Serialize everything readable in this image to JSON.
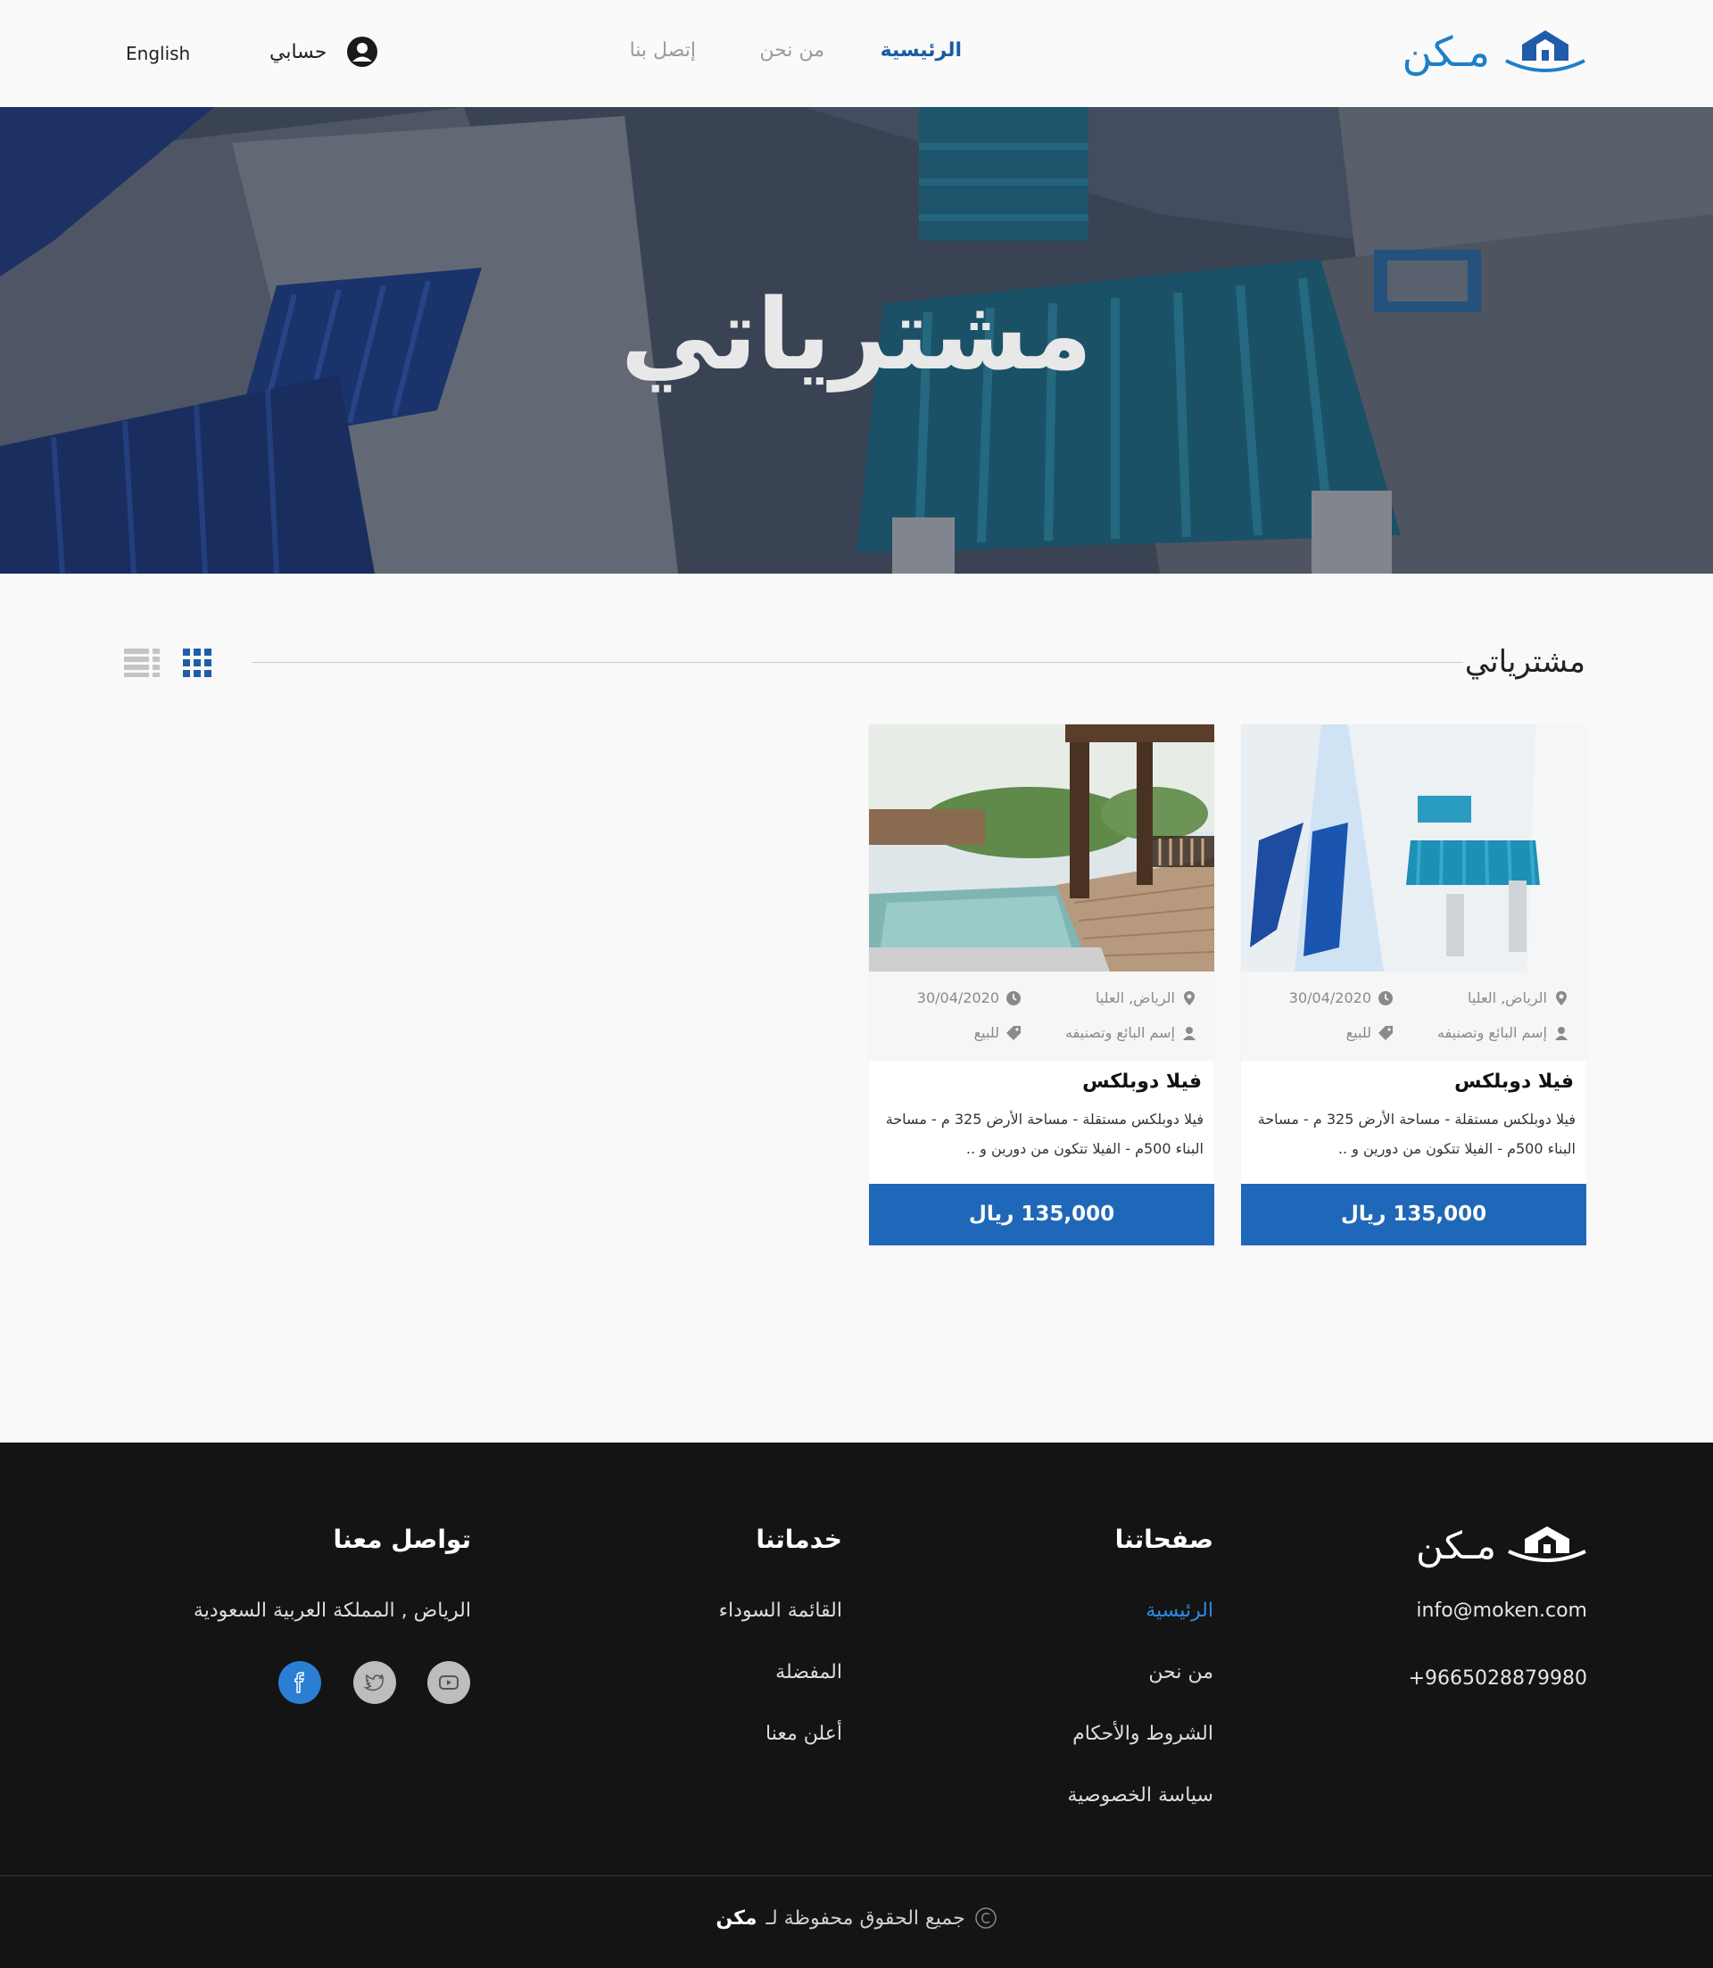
{
  "header": {
    "logo_text": "مـكن",
    "nav": {
      "home": "الرئيسية",
      "about": "من نحن",
      "contact": "إتصل بنا"
    },
    "account_label": "حسابي",
    "language": "English"
  },
  "hero": {
    "title": "مشترياتي"
  },
  "section": {
    "title": "مشترياتي"
  },
  "cards": [
    {
      "location": "الرياض, العليا",
      "date": "30/04/2020",
      "seller": "إسم البائع وتصنيفه",
      "type": "للبيع",
      "title": "فيلا دوبلكس",
      "description": "فيلا دوبلكس مستقلة - مساحة الأرض 325 م - مساحة البناء 500م - الفيلا تتكون من دورين و ..",
      "price": "135,000 ريال"
    },
    {
      "location": "الرياض, العليا",
      "date": "30/04/2020",
      "seller": "إسم البائع وتصنيفه",
      "type": "للبيع",
      "title": "فيلا دوبلكس",
      "description": "فيلا دوبلكس مستقلة - مساحة الأرض 325 م - مساحة البناء 500م - الفيلا تتكون من دورين و ..",
      "price": "135,000 ريال"
    }
  ],
  "footer": {
    "logo_text": "مـكن",
    "email": "info@moken.com",
    "phone": "+9665028879980",
    "pages_heading": "صفحاتنا",
    "pages": [
      "الرئيسية",
      "من نحن",
      "الشروط والأحكام",
      "سياسة الخصوصية"
    ],
    "services_heading": "خدماتنا",
    "services": [
      "القائمة السوداء",
      "المفضلة",
      "أعلن معنا"
    ],
    "contact_heading": "تواصل معنا",
    "address": "الرياض , المملكة العربية السعودية",
    "copyright_text": "جميع الحقوق محفوظة لـ",
    "copyright_brand": "مكن"
  },
  "colors": {
    "primary": "#1f67b8",
    "logo": "#1e7fc8",
    "footer_bg": "#141414",
    "facebook": "#2a7fd4"
  },
  "icons": [
    "logo-house-icon",
    "user-circle-icon",
    "grid-view-icon",
    "list-view-icon",
    "location-pin-icon",
    "clock-icon",
    "user-icon",
    "tag-icon",
    "youtube-icon",
    "twitter-icon",
    "facebook-icon",
    "copyright-icon"
  ]
}
